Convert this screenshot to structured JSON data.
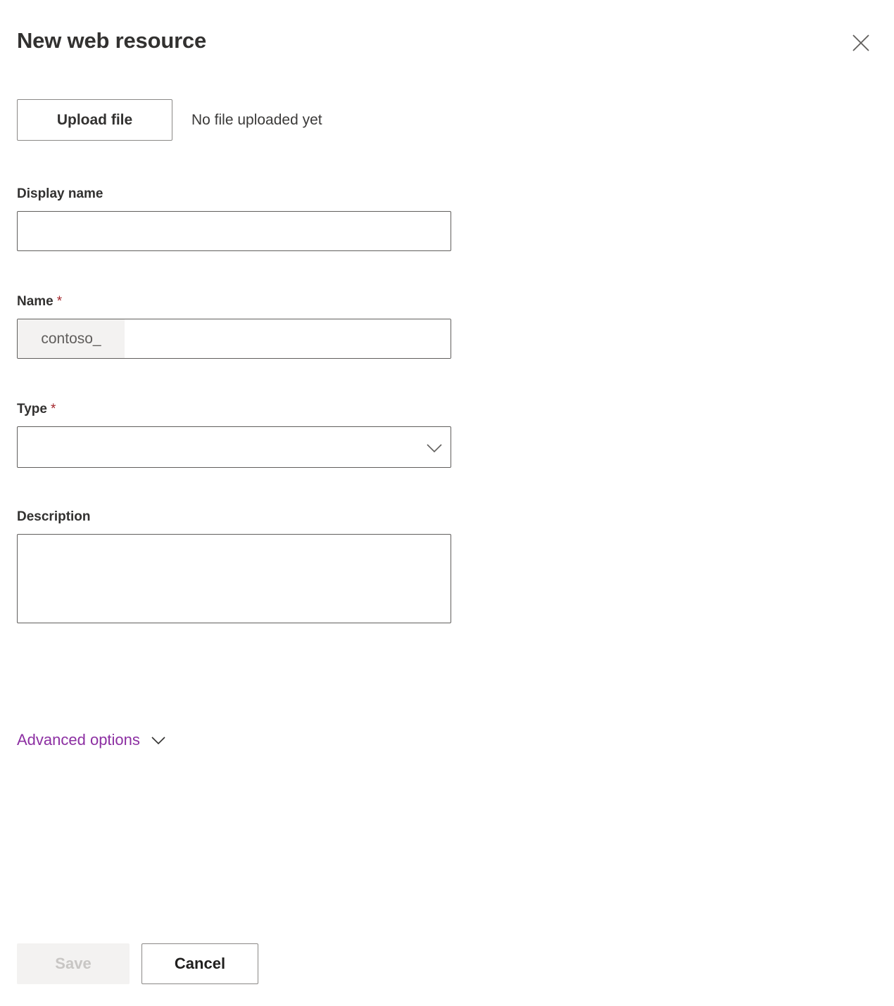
{
  "panel": {
    "title": "New web resource",
    "close_icon": "close-icon"
  },
  "upload": {
    "button_label": "Upload file",
    "status_text": "No file uploaded yet"
  },
  "fields": {
    "display_name": {
      "label": "Display name",
      "value": "",
      "placeholder": ""
    },
    "name": {
      "label": "Name",
      "required_marker": "*",
      "prefix": "contoso_",
      "value": "",
      "placeholder": ""
    },
    "type": {
      "label": "Type",
      "required_marker": "*",
      "value": "",
      "caret_icon": "chevron-down-icon"
    },
    "description": {
      "label": "Description",
      "value": "",
      "placeholder": ""
    }
  },
  "advanced": {
    "label": "Advanced options",
    "caret_icon": "chevron-down-icon"
  },
  "footer": {
    "save_label": "Save",
    "cancel_label": "Cancel"
  },
  "colors": {
    "accent_link": "#8c2fa2",
    "required_asterisk": "#a4262c",
    "border": "#605e5c",
    "button_border": "#8a8886",
    "disabled_bg": "#f3f2f1",
    "disabled_text": "#c8c6c4",
    "text": "#323130"
  }
}
